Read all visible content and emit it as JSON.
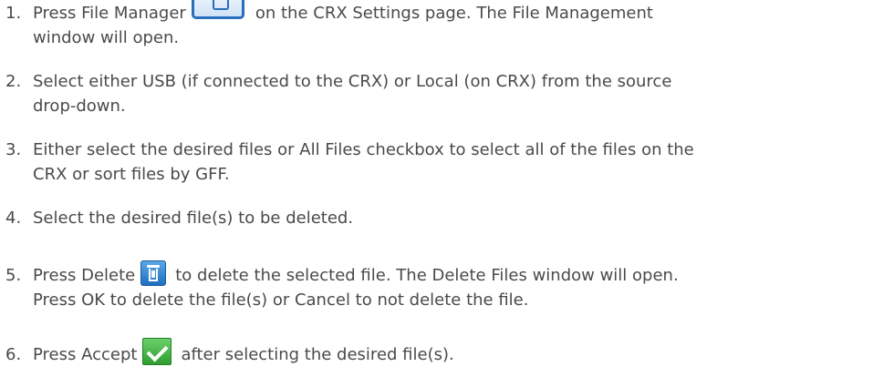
{
  "steps": [
    {
      "number": "1.",
      "lines": [
        "Press File Manager",
        "on the CRX Settings page. The File Management",
        "window will open."
      ]
    },
    {
      "number": "2.",
      "lines": [
        "Select either USB (if connected to the CRX) or Local (on CRX) from the source",
        "drop-down."
      ]
    },
    {
      "number": "3.",
      "lines": [
        "Either select the desired files or All Files checkbox to select all of the files on the",
        "CRX or sort files by GFF."
      ]
    },
    {
      "number": "4.",
      "lines": [
        "Select the desired file(s) to be deleted."
      ]
    },
    {
      "number": "5.",
      "lines": [
        "Press Delete",
        "to delete the selected file. The Delete Files window will open.",
        "Press OK to delete the file(s) or Cancel to not delete the file."
      ]
    },
    {
      "number": "6.",
      "lines": [
        "Press Accept",
        "after selecting the desired file(s)."
      ]
    }
  ],
  "icons": {
    "file_manager": "file-manager-icon",
    "delete": "trash-icon",
    "accept": "checkmark-icon"
  }
}
